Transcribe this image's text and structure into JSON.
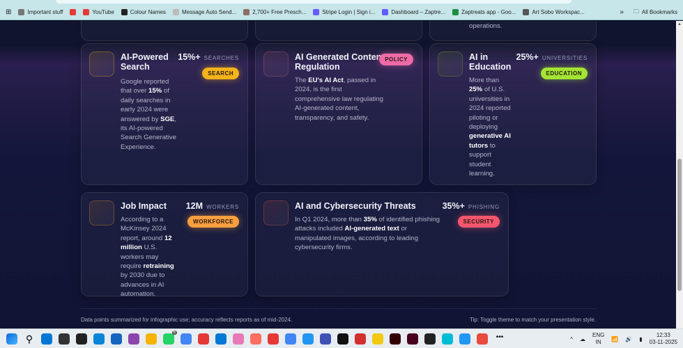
{
  "bookmarks": {
    "items": [
      {
        "label": "Important stuff",
        "color": "#777"
      },
      {
        "label": "",
        "color": "#e53935"
      },
      {
        "label": "YouTube",
        "color": "#e53935"
      },
      {
        "label": "Colour Names",
        "color": "#222"
      },
      {
        "label": "Message Auto Send...",
        "color": "#bbb"
      },
      {
        "label": "2,700+ Free Presch...",
        "color": "#8d6e63"
      },
      {
        "label": "Stripe Login | Sign i...",
        "color": "#635bff"
      },
      {
        "label": "Dashboard – Zaptre...",
        "color": "#635bff"
      },
      {
        "label": "Zaptreats app - Goo...",
        "color": "#1e8e3e"
      },
      {
        "label": "Art Sobo Workspac...",
        "color": "#555"
      }
    ],
    "more": "»",
    "all_label": "All Bookmarks"
  },
  "top_partial": {
    "card3_text": "operations."
  },
  "cards": [
    {
      "title": "AI-Powered Search",
      "stat": "15%+",
      "unit": "SEARCHES",
      "badge": "SEARCH",
      "color": "#f5b21b",
      "icon_border": "#7a5a3a",
      "body": [
        {
          "t": "Google reported that over "
        },
        {
          "t": "15%",
          "b": true
        },
        {
          "t": " of daily searches in early 2024 were answered by "
        },
        {
          "t": "SGE",
          "b": true
        },
        {
          "t": ", its AI-powered Search Generative Experience."
        }
      ]
    },
    {
      "title": "AI Generated Content Regulation",
      "stat": "",
      "unit": "",
      "badge": "POLICY",
      "color": "#f06aa8",
      "icon_border": "#6b3a60",
      "body": [
        {
          "t": "The "
        },
        {
          "t": "EU's AI Act",
          "b": true
        },
        {
          "t": ", passed in 2024, is the first comprehensive law regulating AI-generated content, transparency, and safety."
        }
      ]
    },
    {
      "title": "AI in Education",
      "stat": "25%+",
      "unit": "UNIVERSITIES",
      "badge": "EDUCATION",
      "color": "#a4e334",
      "icon_border": "#4d5a3a",
      "body": [
        {
          "t": "More than "
        },
        {
          "t": "25%",
          "b": true
        },
        {
          "t": " of U.S. universities in 2024 reported piloting or deploying "
        },
        {
          "t": "generative AI tutors",
          "b": true
        },
        {
          "t": " to support student learning."
        }
      ]
    },
    {
      "title": "Job Impact",
      "stat": "12M",
      "unit": "WORKERS",
      "badge": "WORKFORCE",
      "color": "#fb9f3f",
      "icon_border": "#6b4a38",
      "body": [
        {
          "t": "According to a McKinsey 2024 report, around "
        },
        {
          "t": "12 million",
          "b": true
        },
        {
          "t": " U.S. workers may require "
        },
        {
          "t": "retraining",
          "b": true
        },
        {
          "t": " by 2030 due to advances in AI automation."
        }
      ]
    },
    {
      "title": "AI and Cybersecurity Threats",
      "stat": "35%+",
      "unit": "PHISHING",
      "badge": "SECURITY",
      "color": "#f7566e",
      "icon_border": "#6a3440",
      "body": [
        {
          "t": "In Q1 2024, more than "
        },
        {
          "t": "35%",
          "b": true
        },
        {
          "t": " of identified phishing attacks included "
        },
        {
          "t": "AI-generated text",
          "b": true
        },
        {
          "t": " or manipulated images, according to leading cybersecurity firms."
        }
      ]
    }
  ],
  "footer": {
    "note": "Data points summarized for infographic use; accuracy reflects reports as of mid-2024.",
    "tip": "Tip: Toggle theme to match your presentation style."
  },
  "taskbar": {
    "whatsapp_badge": "6",
    "lang": "ENG",
    "region": "IN",
    "time": "12:33",
    "date": "03-11-2025",
    "apps": [
      "#0078d4",
      "#333",
      "#222",
      "#0a84d8",
      "#1565c0",
      "#8e44ad",
      "#f4b400",
      "#25d366",
      "#4285f4",
      "#e53935",
      "#0078d4",
      "#e879b9",
      "#ff6f61",
      "#e53935",
      "#4285f4",
      "#2196f3",
      "#3f51b5",
      "#111",
      "#d32f2f",
      "#f2c811",
      "#330000",
      "#49021f",
      "#222",
      "#00bcd4",
      "#2196f3",
      "#e74c3c"
    ]
  }
}
